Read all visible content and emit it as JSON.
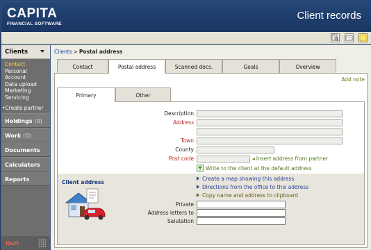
{
  "header": {
    "logo_main": "CAPITA",
    "logo_sub": "FINANCIAL SOFTWARE",
    "app_title": "Client records"
  },
  "toolbar": {
    "icons": [
      "search-document-icon",
      "grid-icon",
      "note-icon"
    ]
  },
  "sidebar": {
    "header": "Clients",
    "items": [
      {
        "label": "Contact",
        "active": true
      },
      {
        "label": "Personal"
      },
      {
        "label": "Account"
      },
      {
        "label": "Data upload"
      },
      {
        "label": "Marketing"
      },
      {
        "label": "Servicing"
      }
    ],
    "create_partner": "Create partner",
    "sections": [
      {
        "label": "Holdings",
        "count": "(0)"
      },
      {
        "label": "Work",
        "count": "(0)"
      },
      {
        "label": "Documents"
      },
      {
        "label": "Calculators"
      },
      {
        "label": "Reports"
      }
    ],
    "quit": "Quit"
  },
  "breadcrumb": {
    "parent": "Clients",
    "separator": ">",
    "current": "Postal address"
  },
  "tabs": [
    {
      "label": "Contact"
    },
    {
      "label": "Postal address",
      "active": true
    },
    {
      "label": "Scanned docs."
    },
    {
      "label": "Goals"
    },
    {
      "label": "Overview"
    }
  ],
  "add_note": "Add note",
  "subtabs": [
    {
      "label": "Primary",
      "active": true
    },
    {
      "label": "Other"
    }
  ],
  "form": {
    "description": "Description",
    "address": "Address",
    "town": "Town",
    "county": "County",
    "postcode": "Post code",
    "insert_partner": "Insert address from partner",
    "write_client": "Write to the client at the default address"
  },
  "client_address": {
    "title": "Client address",
    "map_link": "Create a map showing this address",
    "directions_link": "Directions from the office to this address",
    "copy_link": "Copy name and address to clipboard",
    "private": "Private",
    "letters_to": "Address letters to",
    "salutation": "Salutation"
  },
  "colors": {
    "header_bg": "#1f3c6c",
    "required": "#c02020",
    "link": "#2a3f9a",
    "active_nav": "#ffcf4d",
    "quit": "#ff5a4a"
  }
}
